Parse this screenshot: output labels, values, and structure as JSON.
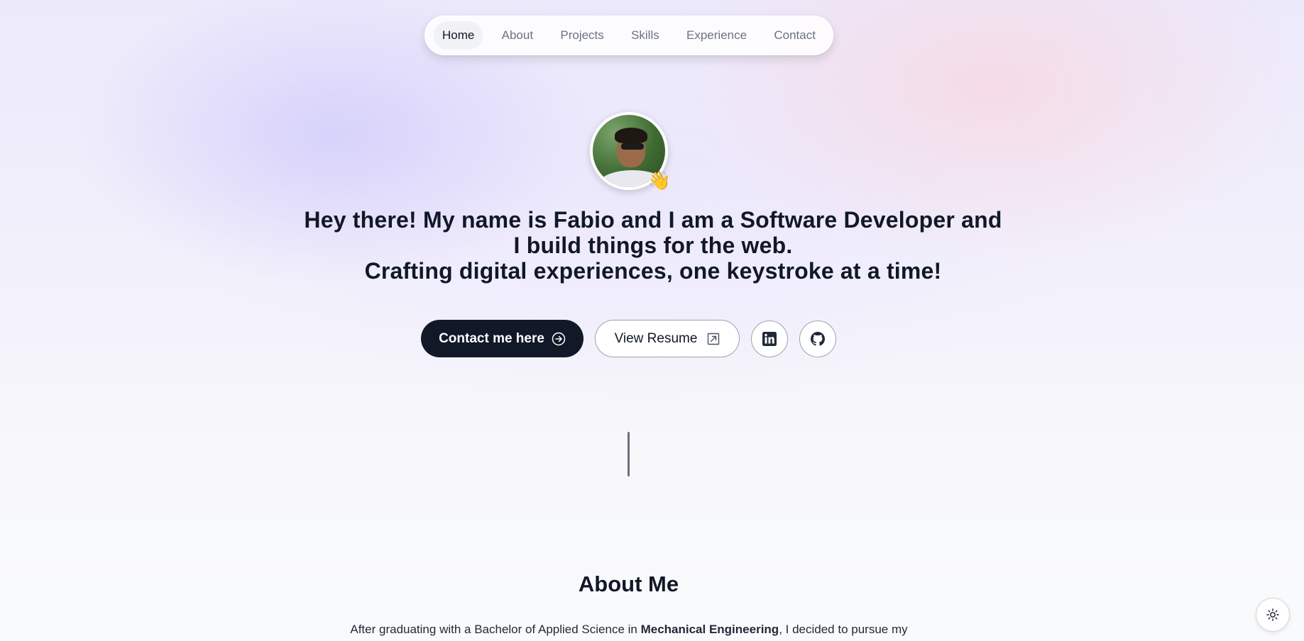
{
  "nav": {
    "items": [
      {
        "label": "Home",
        "active": true
      },
      {
        "label": "About",
        "active": false
      },
      {
        "label": "Projects",
        "active": false
      },
      {
        "label": "Skills",
        "active": false
      },
      {
        "label": "Experience",
        "active": false
      },
      {
        "label": "Contact",
        "active": false
      }
    ]
  },
  "hero": {
    "avatar_badge": "👋",
    "headline": {
      "greeting": "Hey there!",
      "t1": " My name is ",
      "name": "Fabio",
      "t2": " and I am a ",
      "role": "Software Developer",
      "t3": " and I build things for the web.",
      "tagline": "Crafting digital experiences, one keystroke at a time!"
    },
    "contact_button": "Contact me here",
    "resume_button": "View Resume",
    "linkedin_icon": "linkedin-icon",
    "github_icon": "github-icon"
  },
  "about": {
    "title": "About Me",
    "text_prefix": "After graduating with a Bachelor of Applied Science in ",
    "text_bold": "Mechanical Engineering",
    "text_suffix": ", I decided to pursue my"
  },
  "theme_toggle": {
    "icon": "sun-icon"
  },
  "colors": {
    "primary": "#111827",
    "muted": "#6b7280",
    "background": "#f9fafb"
  }
}
